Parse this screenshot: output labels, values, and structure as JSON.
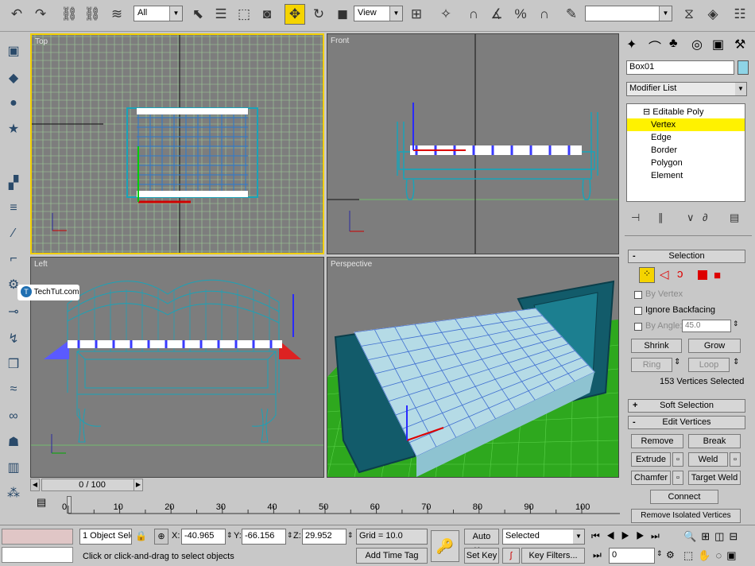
{
  "toolbar": {
    "selection_filter": "All",
    "reference_coord": "View",
    "named_selection": ""
  },
  "viewports": {
    "top": "Top",
    "front": "Front",
    "left": "Left",
    "perspective": "Perspective"
  },
  "watermark": "TechTut.com",
  "command_panel": {
    "object_name": "Box01",
    "modifier_list": "Modifier List",
    "stack": [
      "Editable Poly",
      "Vertex",
      "Edge",
      "Border",
      "Polygon",
      "Element"
    ],
    "selection": {
      "title": "Selection",
      "by_vertex": "By Vertex",
      "ignore_backfacing": "Ignore Backfacing",
      "by_angle": "By Angle:",
      "angle_value": "45.0",
      "shrink": "Shrink",
      "grow": "Grow",
      "ring": "Ring",
      "loop": "Loop",
      "status": "153 Vertices Selected"
    },
    "soft_selection": "Soft Selection",
    "edit_vertices": {
      "title": "Edit Vertices",
      "remove": "Remove",
      "break": "Break",
      "extrude": "Extrude",
      "weld": "Weld",
      "chamfer": "Chamfer",
      "target_weld": "Target Weld",
      "connect": "Connect",
      "remove_isolated": "Remove Isolated Vertices"
    }
  },
  "timeline": {
    "frame_display": "0 / 100",
    "ticks": [
      "0",
      "10",
      "20",
      "30",
      "40",
      "50",
      "60",
      "70",
      "80",
      "90",
      "100"
    ]
  },
  "statusbar": {
    "selection_count": "1 Object Sele",
    "x_label": "X:",
    "x_value": "-40.965",
    "y_label": "Y:",
    "y_value": "-66.156",
    "z_label": "Z:",
    "z_value": "29.952",
    "grid": "Grid = 10.0",
    "prompt": "Click or click-and-drag to select objects",
    "add_time_tag": "Add Time Tag",
    "auto_key": "Auto Key",
    "set_key": "Set Key",
    "key_filter_value": "Selected",
    "key_filters": "Key Filters...",
    "current_frame": "0"
  },
  "colors": {
    "active_border": "#f1d000",
    "viewport_bg": "#7d7d7d",
    "grid": "#9fd19a",
    "wire": "#1aa3b8",
    "selection_blue": "#3a3aff"
  }
}
